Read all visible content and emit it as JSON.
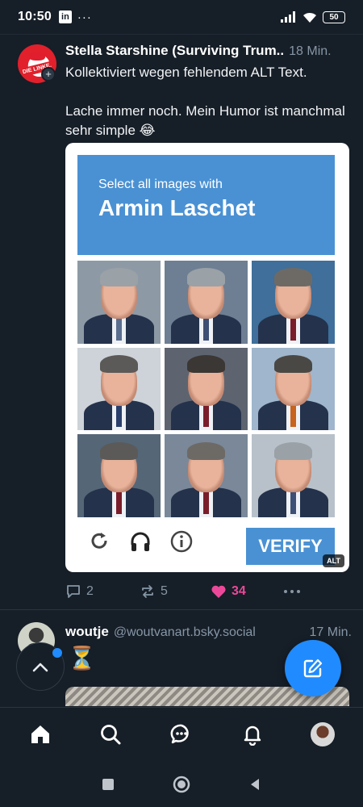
{
  "status": {
    "time": "10:50",
    "linkedin": "in",
    "dots": "···",
    "battery": "50"
  },
  "post1": {
    "author": "Stella Starshine (Surviving Trum..",
    "time_ago": "18 Min.",
    "avatar_text": "DIE LINKE.",
    "text_lines": [
      "Kollektiviert wegen fehlendem ALT Text.",
      "Lache immer noch. Mein Humor ist manchmal sehr simple 😂"
    ],
    "captcha": {
      "subtitle": "Select all images with",
      "name": "Armin Laschet",
      "verify_label": "VERIFY"
    },
    "alt_badge": "ALT",
    "actions": {
      "replies": "2",
      "reposts": "5",
      "likes": "34"
    }
  },
  "post2": {
    "author": "woutje",
    "handle": "@woutvanart.bsky.social",
    "time_ago": "17 Min.",
    "emoji": "⏳"
  },
  "icons": {
    "reply": "reply-icon",
    "repost": "repost-icon",
    "like": "heart-icon",
    "more": "more-icon",
    "compose": "compose-icon",
    "scroll_top": "chevron-up-icon"
  },
  "colors": {
    "background": "#161e27",
    "accent": "#208bfe",
    "like": "#ec4899",
    "captcha_blue": "#4a91d3"
  }
}
